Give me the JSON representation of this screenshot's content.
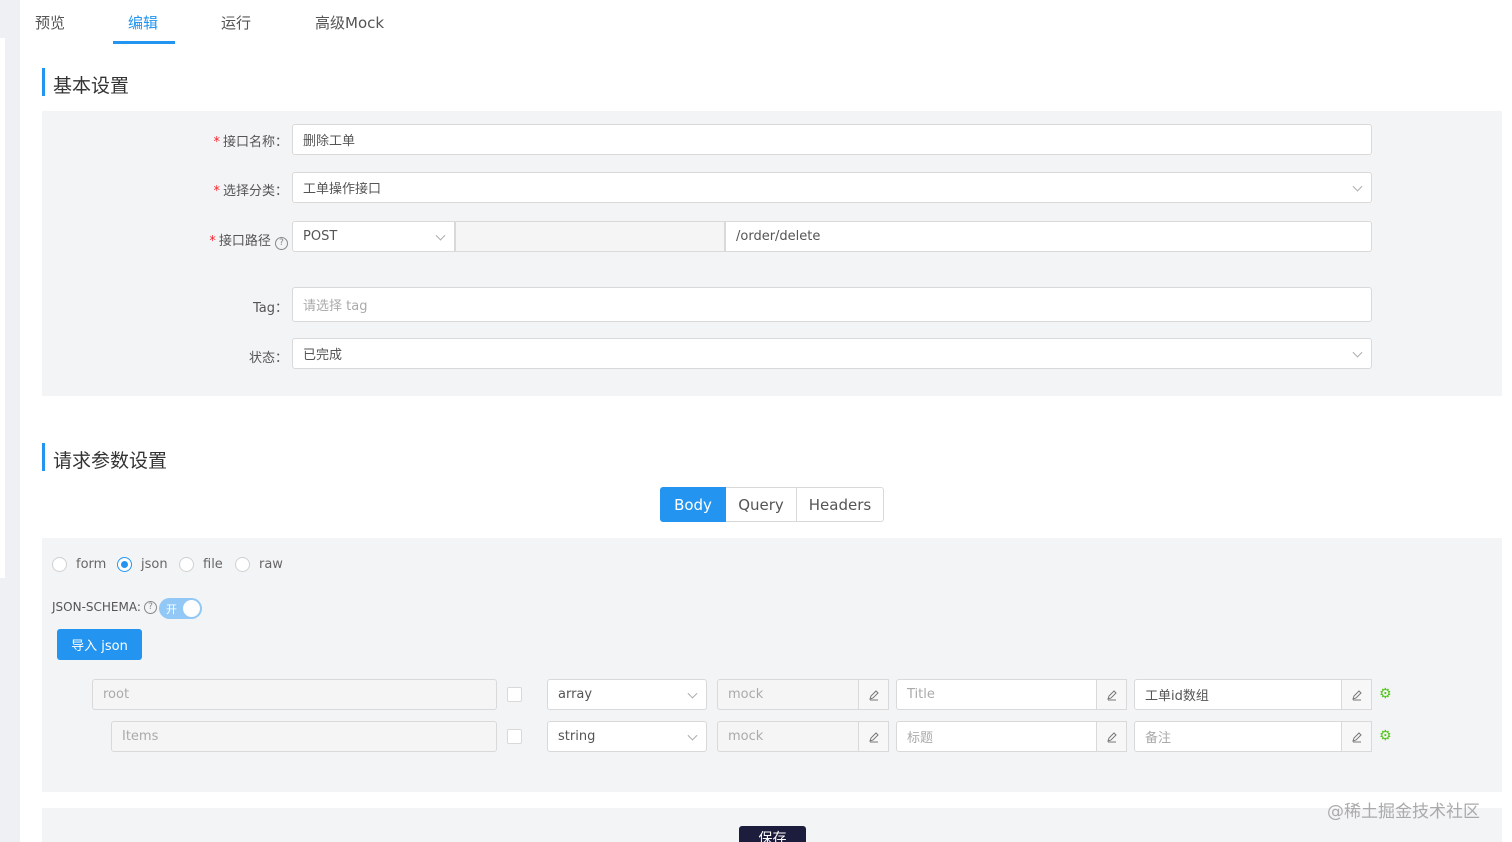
{
  "tabs": [
    {
      "label": "预览"
    },
    {
      "label": "编辑"
    },
    {
      "label": "运行"
    },
    {
      "label": "高级Mock"
    }
  ],
  "basic": {
    "title": "基本设置",
    "name_label": "接口名称：",
    "name_value": "删除工单",
    "category_label": "选择分类：",
    "category_value": "工单操作接口",
    "path_label": "接口路径",
    "path_method": "POST",
    "path_value": "/order/delete",
    "tag_label": "Tag：",
    "tag_placeholder": "请选择 tag",
    "status_label": "状态：",
    "status_value": "已完成",
    "required_mark": "*",
    "help_icon": "?"
  },
  "request": {
    "title": "请求参数设置",
    "segments": [
      {
        "label": "Body"
      },
      {
        "label": "Query"
      },
      {
        "label": "Headers"
      }
    ],
    "body_types": [
      {
        "label": "form"
      },
      {
        "label": "json"
      },
      {
        "label": "file"
      },
      {
        "label": "raw"
      }
    ],
    "schema_label": "JSON-SCHEMA:",
    "schema_toggle": "开",
    "import_button": "导入 json",
    "rows": [
      {
        "name": "root",
        "type": "array",
        "mock": "mock",
        "title": "Title",
        "desc": "工单id数组"
      },
      {
        "name": "Items",
        "type": "string",
        "mock": "mock",
        "title": "标题",
        "desc": "备注"
      }
    ]
  },
  "save_button": "保存",
  "watermark": "@稀土掘金技术社区",
  "colors": {
    "accent": "#2395f1",
    "required": "#f5222d",
    "settings": "#52c41a"
  }
}
